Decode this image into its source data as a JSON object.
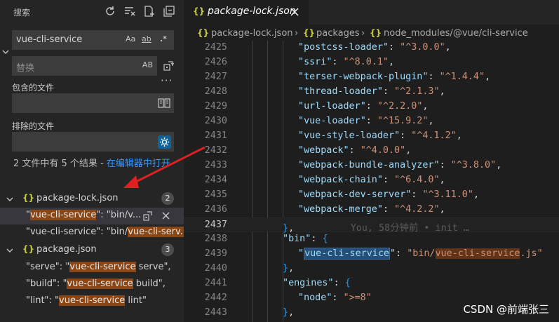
{
  "sidebar": {
    "title": "搜索",
    "search": {
      "value": "vue-cli-service",
      "opt_case": "Aa",
      "opt_word": "ab",
      "opt_regex": ".*"
    },
    "replace": {
      "placeholder": "替换",
      "opt_preserve": "AB"
    },
    "more": "···",
    "include_label": "包含的文件",
    "exclude_label": "排除的文件",
    "summary": {
      "text": "2 文件中有 5 个结果 - ",
      "link": "在编辑器中打开"
    },
    "results": [
      {
        "file": "package-lock.json",
        "count": "2",
        "matches": [
          {
            "before": "\"",
            "hl": "vue-cli-service",
            "after": "\": \"bin/v..."
          },
          {
            "before": "\"vue-cli-service\": \"bin/",
            "hl": "vue-cli-serv...",
            "after": ""
          }
        ]
      },
      {
        "file": "package.json",
        "count": "3",
        "matches": [
          {
            "before": "\"serve\": \"",
            "hl": "vue-cli-service",
            "after": " serve\","
          },
          {
            "before": "\"build\": \"",
            "hl": "vue-cli-service",
            "after": " build\","
          },
          {
            "before": "\"lint\": \"",
            "hl": "vue-cli-service",
            "after": " lint\""
          }
        ]
      }
    ]
  },
  "editor": {
    "tab": {
      "name": "package-lock.json",
      "icon": "{}"
    },
    "breadcrumb": {
      "file": "package-lock.json",
      "sep": "›",
      "seg1": "packages",
      "seg2": "node_modules/@vue/cli-service",
      "icon": "{}"
    },
    "blame": "You, 58分钟前 • init …",
    "lines": [
      {
        "n": "2425",
        "key": "postcss-loader",
        "val": "^3.0.0"
      },
      {
        "n": "2426",
        "key": "ssri",
        "val": "^8.0.1"
      },
      {
        "n": "2427",
        "key": "terser-webpack-plugin",
        "val": "^1.4.4"
      },
      {
        "n": "2428",
        "key": "thread-loader",
        "val": "^2.1.3"
      },
      {
        "n": "2429",
        "key": "url-loader",
        "val": "^2.2.0"
      },
      {
        "n": "2430",
        "key": "vue-loader",
        "val": "^15.9.2"
      },
      {
        "n": "2431",
        "key": "vue-style-loader",
        "val": "^4.1.2"
      },
      {
        "n": "2432",
        "key": "webpack",
        "val": "^4.0.0"
      },
      {
        "n": "2433",
        "key": "webpack-bundle-analyzer",
        "val": "^3.8.0"
      },
      {
        "n": "2434",
        "key": "webpack-chain",
        "val": "^6.4.0"
      },
      {
        "n": "2435",
        "key": "webpack-dev-server",
        "val": "^3.11.0"
      },
      {
        "n": "2436",
        "key": "webpack-merge",
        "val": "^4.2.2"
      }
    ],
    "n2437": "2437",
    "n2438": "2438",
    "n2439": "2439",
    "n2440": "2440",
    "n2441": "2441",
    "n2442": "2442",
    "n2443": "2443",
    "bin_key": "bin",
    "bin_entry_key": "vue-cli-service",
    "bin_entry_val_pre": "bin/",
    "bin_entry_val_hl": "vue-cli-service",
    "bin_entry_val_post": ".js",
    "engines_key": "engines",
    "node_key": "node",
    "node_val": ">=8"
  },
  "watermark": "CSDN @前端张三",
  "colors": {
    "highlight": "#8a4614",
    "link": "#3794ff",
    "arrow": "#e02020"
  }
}
